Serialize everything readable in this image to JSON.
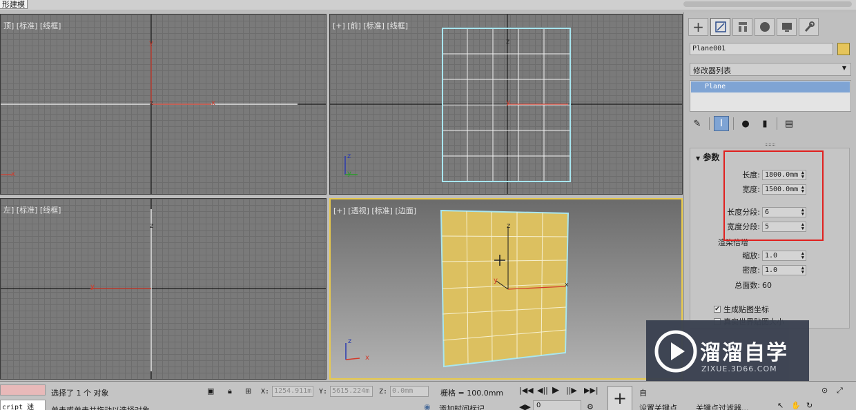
{
  "title_bar": {
    "title": "形建模"
  },
  "viewports": {
    "top": {
      "label": "顶] [标准] [线框]"
    },
    "front": {
      "label": "[+] [前] [标准] [线框]"
    },
    "left": {
      "label": "左] [标准] [线框]"
    },
    "perspective": {
      "label": "[+] [透视] [标准] [边面]"
    }
  },
  "axes": {
    "x": "x",
    "y": "y",
    "z": "z"
  },
  "command_panel": {
    "tabs": [
      {
        "name": "create-tab",
        "icon": "plus-icon"
      },
      {
        "name": "modify-tab",
        "icon": "modify-icon"
      },
      {
        "name": "hierarchy-tab",
        "icon": "hierarchy-icon"
      },
      {
        "name": "motion-tab",
        "icon": "motion-icon"
      },
      {
        "name": "display-tab",
        "icon": "display-icon"
      },
      {
        "name": "utilities-tab",
        "icon": "wrench-icon"
      }
    ],
    "object_name": "Plane001",
    "object_color": "#e5c45a",
    "modifier_list": "修改器列表",
    "stack_item": "Plane",
    "rollout_title": "参数",
    "length_label": "长度:",
    "length_value": "1800.0mm",
    "width_label": "宽度:",
    "width_value": "1500.0mm",
    "length_segs_label": "长度分段:",
    "length_segs_value": "6",
    "width_segs_label": "宽度分段:",
    "width_segs_value": "5",
    "render_multipliers": "渲染倍增",
    "scale_label": "缩放:",
    "scale_value": "1.0",
    "density_label": "密度:",
    "density_value": "1.0",
    "total_faces_label": "总面数:",
    "total_faces_value": "60",
    "gen_map_coords": "生成贴图坐标",
    "real_world_map": "真实世界贴图大小"
  },
  "status_bar": {
    "maxscript_label": "cript 迷",
    "selection_text": "选择了 1 个 对象",
    "prompt_text": "单击或单击并拖动以选择对象",
    "x_label": "X:",
    "x_value": "1254.911m",
    "y_label": "Y:",
    "y_value": "5615.224m",
    "z_label": "Z:",
    "z_value": "0.0mm",
    "grid_text": "栅格 = 100.0mm",
    "add_time_tag": "添加时间标记",
    "auto_key": "自",
    "frame_value": "0",
    "set_key": "设置关键点",
    "key_filters": "关键点过滤器..."
  },
  "watermark": {
    "brand": "溜溜自学",
    "url": "ZIXUE.3D66.COM"
  },
  "colors": {
    "highlight_box": "#e0201e",
    "selection_yellow": "#e8c94a",
    "plane_fill": "#dcc060",
    "axis_red": "#d33a2a"
  }
}
